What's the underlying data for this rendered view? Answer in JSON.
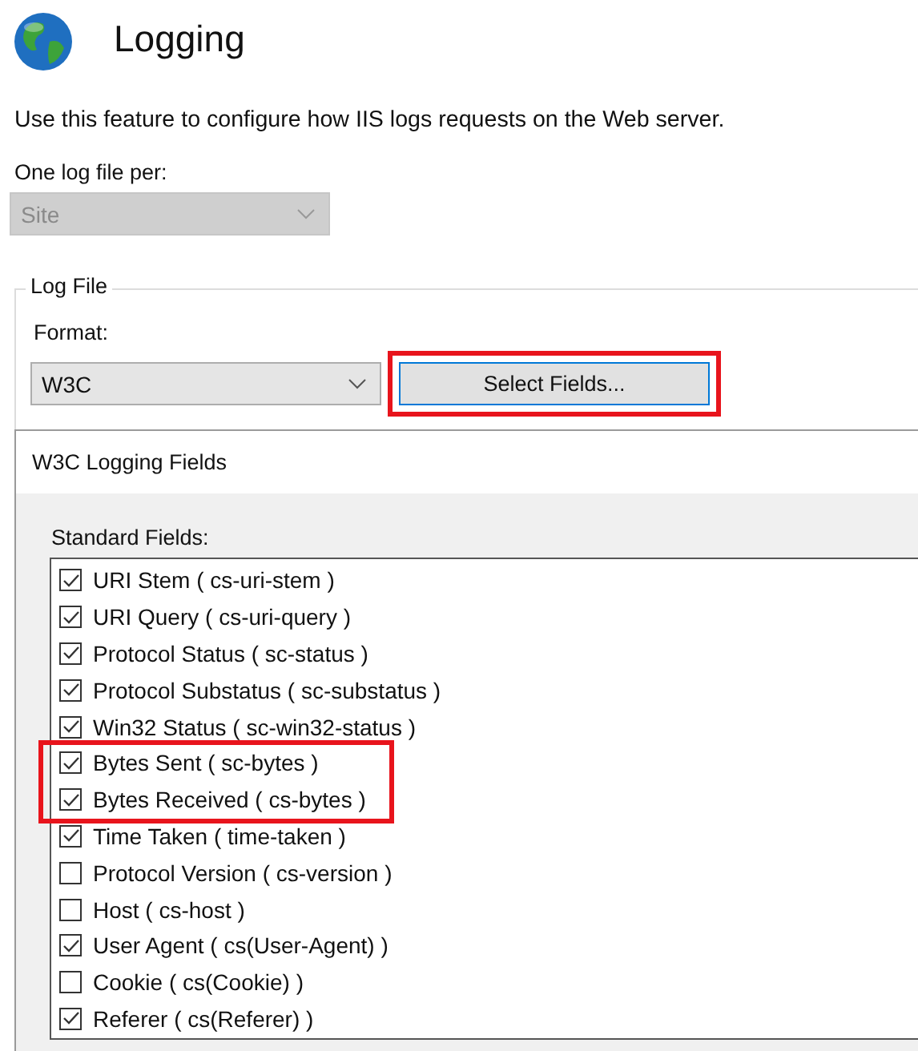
{
  "page": {
    "title": "Logging",
    "description": "Use this feature to configure how IIS logs requests on the Web server.",
    "log_file_per": {
      "label": "One log file per:",
      "value": "Site",
      "disabled": true
    }
  },
  "log_file": {
    "legend": "Log File",
    "format": {
      "label": "Format:",
      "value": "W3C",
      "disabled": false
    },
    "select_fields_button": {
      "label": "Select Fields...",
      "highlighted": true
    }
  },
  "dialog": {
    "title": "W3C Logging Fields",
    "standard_fields_label": "Standard Fields:",
    "fields": [
      {
        "label": "URI Stem ( cs-uri-stem )",
        "checked": true,
        "highlighted": false
      },
      {
        "label": "URI Query ( cs-uri-query )",
        "checked": true,
        "highlighted": false
      },
      {
        "label": "Protocol Status ( sc-status )",
        "checked": true,
        "highlighted": false
      },
      {
        "label": "Protocol Substatus ( sc-substatus )",
        "checked": true,
        "highlighted": false
      },
      {
        "label": "Win32 Status ( sc-win32-status )",
        "checked": true,
        "highlighted": false
      },
      {
        "label": "Bytes Sent ( sc-bytes )",
        "checked": true,
        "highlighted": true
      },
      {
        "label": "Bytes Received ( cs-bytes )",
        "checked": true,
        "highlighted": true
      },
      {
        "label": "Time Taken ( time-taken )",
        "checked": true,
        "highlighted": false
      },
      {
        "label": "Protocol Version ( cs-version )",
        "checked": false,
        "highlighted": false
      },
      {
        "label": "Host ( cs-host )",
        "checked": false,
        "highlighted": false
      },
      {
        "label": "User Agent ( cs(User-Agent) )",
        "checked": true,
        "highlighted": false
      },
      {
        "label": "Cookie ( cs(Cookie) )",
        "checked": false,
        "highlighted": false
      },
      {
        "label": "Referer ( cs(Referer) )",
        "checked": true,
        "highlighted": false
      }
    ]
  }
}
